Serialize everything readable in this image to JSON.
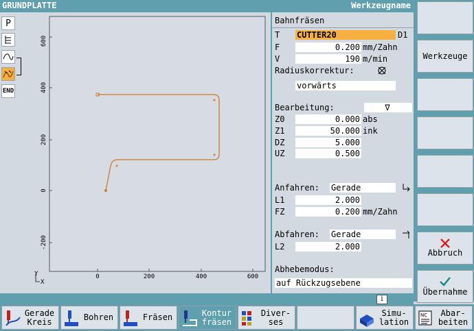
{
  "title": {
    "left": "GRUNDPLATTE",
    "right": "Werkzeugname"
  },
  "left_toolbar": {
    "p": "P",
    "end": "END"
  },
  "canvas": {
    "x_ticks": [
      "0",
      "200",
      "400",
      "600"
    ],
    "y_ticks": [
      "600",
      "400",
      "200",
      "0",
      "-200"
    ],
    "x_axis": "X",
    "y_axis": "Y"
  },
  "panel": {
    "header": "Bahnfräsen",
    "t_label": "T",
    "t_value": "CUTTER20",
    "t_d": "D1",
    "f_label": "F",
    "f_value": "0.200",
    "f_unit": "mm/Zahn",
    "v_label": "V",
    "v_value": "190",
    "v_unit": "m/min",
    "radius_label": "Radiuskorrektur:",
    "radius_value": "vorwärts",
    "bearbeitung_label": "Bearbeitung:",
    "bearbeitung_value": "∇",
    "z0_label": "Z0",
    "z0_value": "0.000",
    "z0_unit": "abs",
    "z1_label": "Z1",
    "z1_value": "50.000",
    "z1_unit": "ink",
    "dz_label": "DZ",
    "dz_value": "5.000",
    "uz_label": "UZ",
    "uz_value": "0.500",
    "anfahren_label": "Anfahren:",
    "anfahren_value": "Gerade",
    "l1_label": "L1",
    "l1_value": "2.000",
    "fz_label": "FZ",
    "fz_value": "0.200",
    "fz_unit": "mm/Zahn",
    "abfahren_label": "Abfahren:",
    "abfahren_value": "Gerade",
    "l2_label": "L2",
    "l2_value": "2.000",
    "abhebe_label": "Abhebemodus:",
    "abhebe_value": "auf Rückzugsebene"
  },
  "right_buttons": {
    "werkzeuge": "Werkzeuge",
    "abbruch": "Abbruch",
    "uebernahme": "Übernahme"
  },
  "bottom_buttons": {
    "gerade_kreis_1": "Gerade",
    "gerade_kreis_2": "Kreis",
    "bohren": "Bohren",
    "fraesen": "Fräsen",
    "kontur_1": "Kontur",
    "kontur_2": "fräsen",
    "diverses_1": "Diver-",
    "diverses_2": "ses",
    "simulation_1": "Simu-",
    "simulation_2": "lation",
    "abarbeiten_1": "Abar-",
    "abarbeiten_2": "beiten"
  },
  "colors": {
    "accent": "#5f9fae",
    "highlight": "#f6b040",
    "contour": "#d07a2a",
    "cancel": "#e02020",
    "ok": "#1a8a8a"
  }
}
